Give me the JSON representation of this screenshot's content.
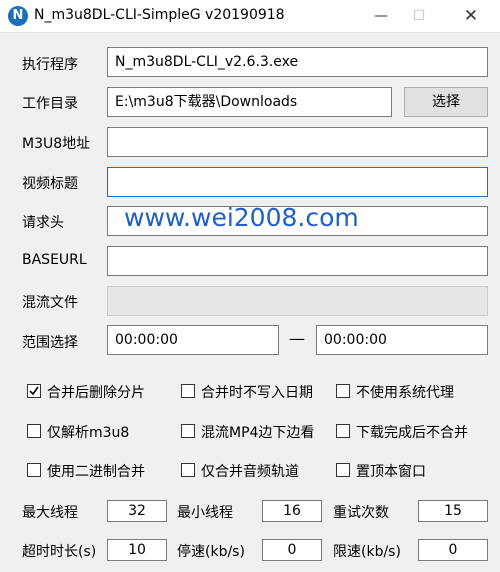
{
  "window": {
    "icon_letter": "N",
    "title": "N_m3u8DL-CLI-SimpleG v20190918",
    "minimize_glyph": "—",
    "maximize_glyph": "☐",
    "close_glyph": "✕"
  },
  "form": {
    "exe_label": "执行程序",
    "exe_value": "N_m3u8DL-CLI_v2.6.3.exe",
    "workdir_label": "工作目录",
    "workdir_value": "E:\\m3u8下载器\\Downloads",
    "browse_button": "选择",
    "url_label": "M3U8地址",
    "url_value": "",
    "title_label": "视频标题",
    "title_value": "",
    "headers_label": "请求头",
    "headers_value": "",
    "baseurl_label": "BASEURL",
    "baseurl_value": "",
    "mux_label": "混流文件",
    "mux_value": "",
    "range_label": "范围选择",
    "range_start": "00:00:00",
    "range_sep": "—",
    "range_end": "00:00:00"
  },
  "options": [
    {
      "label": "合并后删除分片",
      "checked": true
    },
    {
      "label": "合并时不写入日期",
      "checked": false
    },
    {
      "label": "不使用系统代理",
      "checked": false
    },
    {
      "label": "仅解析m3u8",
      "checked": false
    },
    {
      "label": "混流MP4边下边看",
      "checked": false
    },
    {
      "label": "下载完成后不合并",
      "checked": false
    },
    {
      "label": "使用二进制合并",
      "checked": false
    },
    {
      "label": "仅合并音频轨道",
      "checked": false
    },
    {
      "label": "置顶本窗口",
      "checked": false
    }
  ],
  "params": {
    "max_threads_label": "最大线程",
    "max_threads": "32",
    "min_threads_label": "最小线程",
    "min_threads": "16",
    "retry_label": "重试次数",
    "retry": "15",
    "timeout_label": "超时时长(s)",
    "timeout": "10",
    "stop_speed_label": "停速(kb/s)",
    "stop_speed": "0",
    "limit_speed_label": "限速(kb/s)",
    "limit_speed": "0"
  },
  "watermark": "www.wei2008.com",
  "colors": {
    "accent": "#0078d7",
    "watermark": "#1f5fc7",
    "app_icon": "#1b6fb8"
  }
}
